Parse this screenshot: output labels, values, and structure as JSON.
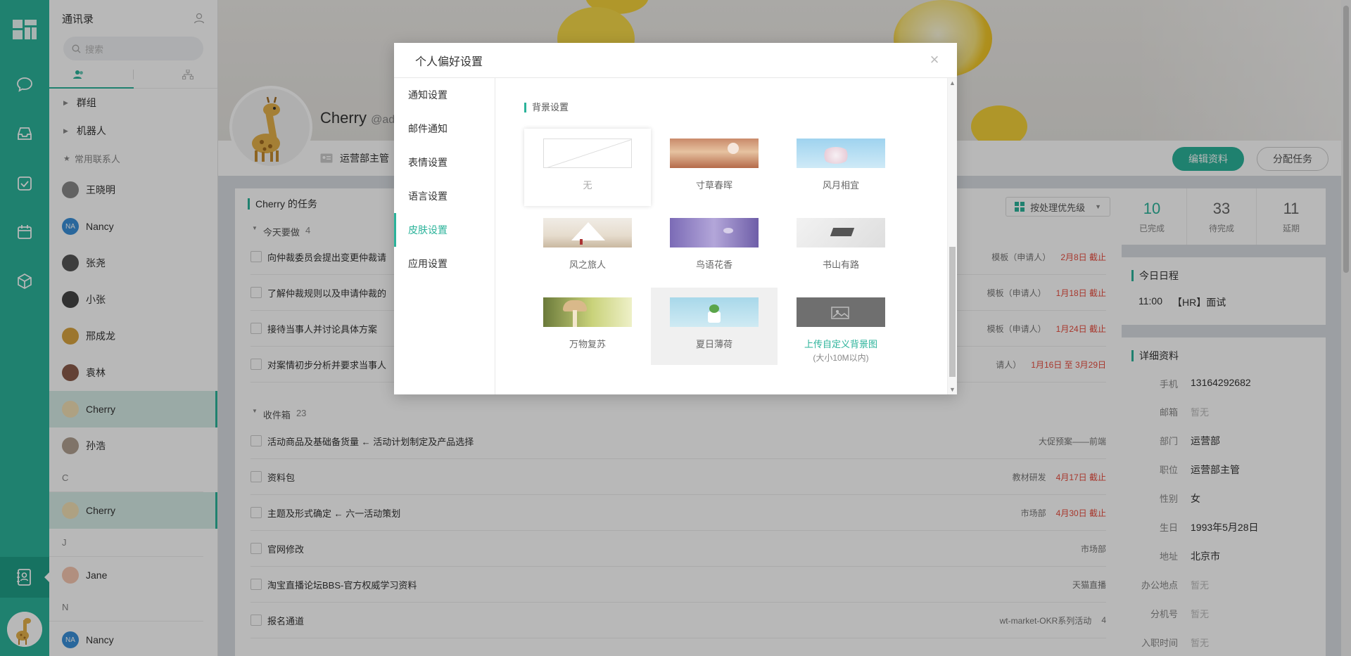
{
  "contacts": {
    "title": "通讯录",
    "search_placeholder": "搜索",
    "groups": [
      "群组",
      "机器人"
    ],
    "frequent_label": "常用联系人",
    "frequent": [
      {
        "name": "王晓明",
        "initials": ""
      },
      {
        "name": "Nancy",
        "initials": "NA"
      },
      {
        "name": "张尧",
        "initials": ""
      },
      {
        "name": "小张",
        "initials": ""
      },
      {
        "name": "邢成龙",
        "initials": ""
      },
      {
        "name": "袁林",
        "initials": ""
      },
      {
        "name": "Cherry",
        "initials": ""
      },
      {
        "name": "孙浩",
        "initials": ""
      }
    ],
    "letter_c": "C",
    "c_person": "Cherry",
    "letter_j": "J",
    "j_person": "Jane",
    "letter_n": "N",
    "n_person": "Nancy",
    "n_initials": "NA"
  },
  "profile": {
    "name": "Cherry",
    "handle": "@ad",
    "dept": "运营部主管",
    "edit_label": "编辑资料",
    "assign_label": "分配任务"
  },
  "tasks": {
    "title": "Cherry 的任务",
    "priority_label": "按处理优先级",
    "today_label": "今天要做",
    "today_count": "4",
    "today": [
      {
        "text": "向仲裁委员会提出变更仲裁请",
        "meta": "模板（申请人）",
        "due": "2月8日 截止"
      },
      {
        "text": "了解仲裁规则以及申请仲裁的",
        "meta": "模板（申请人）",
        "due": "1月18日 截止"
      },
      {
        "text": "接待当事人并讨论具体方案",
        "meta": "模板（申请人）",
        "due": "1月24日 截止"
      },
      {
        "text": "对案情初步分析并要求当事人",
        "meta": "请人）",
        "due": "1月16日 至 3月29日"
      }
    ],
    "inbox_label": "收件箱",
    "inbox_count": "23",
    "inbox": [
      {
        "text": "活动商品及基础备货量 ← 活动计划制定及产品选择",
        "meta": "大促预案——前端",
        "due": ""
      },
      {
        "text": "资料包",
        "meta": "教材研发",
        "due": "4月17日 截止"
      },
      {
        "text": "主题及形式确定 ← 六一活动策划",
        "meta": "市场部",
        "due": "4月30日 截止"
      },
      {
        "text": "官网修改",
        "meta": "市场部",
        "due": ""
      },
      {
        "text": "淘宝直播论坛BBS-官方权威学习资料",
        "meta": "天猫直播",
        "due": ""
      },
      {
        "text": "报名通道",
        "meta": "wt-market-OKR系列活动",
        "due": "4"
      }
    ]
  },
  "stats": [
    {
      "num": "10",
      "label": "已完成"
    },
    {
      "num": "33",
      "label": "待完成"
    },
    {
      "num": "11",
      "label": "延期"
    }
  ],
  "schedule": {
    "title": "今日日程",
    "time": "11:00",
    "event": "【HR】面试"
  },
  "detail": {
    "title": "详细资料",
    "rows": [
      {
        "k": "手机",
        "v": "13164292682",
        "muted": false
      },
      {
        "k": "邮箱",
        "v": "暂无",
        "muted": true
      },
      {
        "k": "部门",
        "v": "运营部",
        "muted": false
      },
      {
        "k": "职位",
        "v": "运营部主管",
        "muted": false
      },
      {
        "k": "性别",
        "v": "女",
        "muted": false
      },
      {
        "k": "生日",
        "v": "1993年5月28日",
        "muted": false
      },
      {
        "k": "地址",
        "v": "北京市",
        "muted": false
      },
      {
        "k": "办公地点",
        "v": "暂无",
        "muted": true
      },
      {
        "k": "分机号",
        "v": "暂无",
        "muted": true
      },
      {
        "k": "入职时间",
        "v": "暂无",
        "muted": true
      }
    ]
  },
  "modal": {
    "title": "个人偏好设置",
    "nav": [
      "通知设置",
      "邮件通知",
      "表情设置",
      "语言设置",
      "皮肤设置",
      "应用设置"
    ],
    "active_nav": 4,
    "section_title": "背景设置",
    "skins": [
      "无",
      "寸草春晖",
      "风月相宜",
      "风之旅人",
      "鸟语花香",
      "书山有路",
      "万物复苏",
      "夏日薄荷",
      "上传自定义背景图"
    ],
    "upload_hint": "(大小10M以内)"
  },
  "colors": {
    "accent": "#2bb39a",
    "due": "#e84c3d"
  }
}
